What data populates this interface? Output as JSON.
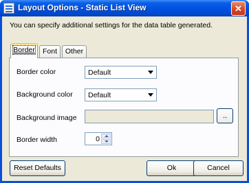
{
  "window": {
    "title": "Layout Options - Static List View",
    "close_glyph": "✕",
    "icon": "app-list-icon"
  },
  "description": "You can specify additional settings for the data table generated.",
  "tabs": [
    {
      "label": "Border",
      "active": true
    },
    {
      "label": "Font",
      "active": false
    },
    {
      "label": "Other",
      "active": false
    }
  ],
  "border_tab": {
    "border_color": {
      "label": "Border color",
      "value": "Default"
    },
    "background_color": {
      "label": "Background color",
      "value": "Default"
    },
    "background_image": {
      "label": "Background image",
      "value": "",
      "browse_label": ".."
    },
    "border_width": {
      "label": "Border width",
      "value": "0"
    }
  },
  "buttons": {
    "reset": "Reset Defaults",
    "ok": "Ok",
    "cancel": "Cancel"
  }
}
